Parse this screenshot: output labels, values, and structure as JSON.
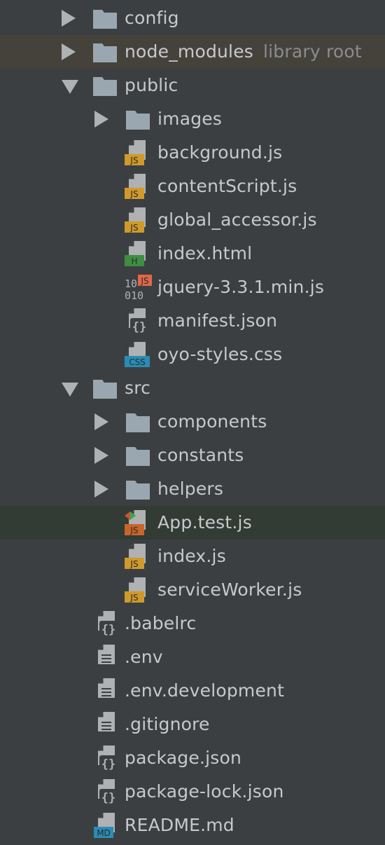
{
  "project_tree": {
    "items": [
      {
        "level": 0,
        "type": "folder",
        "arrow": "collapsed",
        "name": "config",
        "icon": "folder-icon",
        "highlight": ""
      },
      {
        "level": 0,
        "type": "folder",
        "arrow": "collapsed",
        "name": "node_modules",
        "hint": "library root",
        "icon": "folder-icon",
        "highlight": "brown"
      },
      {
        "level": 0,
        "type": "folder",
        "arrow": "expanded",
        "name": "public",
        "icon": "folder-icon",
        "highlight": ""
      },
      {
        "level": 1,
        "type": "folder",
        "arrow": "collapsed",
        "name": "images",
        "icon": "folder-icon",
        "highlight": ""
      },
      {
        "level": 1,
        "type": "file",
        "name": "background.js",
        "icon": "js-file-icon",
        "badge": "JS",
        "badge_color": "#d09a2a",
        "highlight": ""
      },
      {
        "level": 1,
        "type": "file",
        "name": "contentScript.js",
        "icon": "js-file-icon",
        "badge": "JS",
        "badge_color": "#d09a2a",
        "highlight": ""
      },
      {
        "level": 1,
        "type": "file",
        "name": "global_accessor.js",
        "icon": "js-file-icon",
        "badge": "JS",
        "badge_color": "#d09a2a",
        "highlight": ""
      },
      {
        "level": 1,
        "type": "file",
        "name": "index.html",
        "icon": "html-file-icon",
        "badge": "H",
        "badge_color": "#3e8e41",
        "highlight": ""
      },
      {
        "level": 1,
        "type": "file",
        "name": "jquery-3.3.1.min.js",
        "icon": "minified-js-file-icon",
        "badge": "JS",
        "badge_color": "#e0674a",
        "highlight": ""
      },
      {
        "level": 1,
        "type": "file",
        "name": "manifest.json",
        "icon": "json-file-icon",
        "highlight": ""
      },
      {
        "level": 1,
        "type": "file",
        "name": "oyo-styles.css",
        "icon": "css-file-icon",
        "badge": "CSS",
        "badge_color": "#2a8cb4",
        "highlight": ""
      },
      {
        "level": 0,
        "type": "folder",
        "arrow": "expanded",
        "name": "src",
        "icon": "folder-icon",
        "highlight": ""
      },
      {
        "level": 1,
        "type": "folder",
        "arrow": "collapsed",
        "name": "components",
        "icon": "folder-icon",
        "highlight": ""
      },
      {
        "level": 1,
        "type": "folder",
        "arrow": "collapsed",
        "name": "constants",
        "icon": "folder-icon",
        "highlight": ""
      },
      {
        "level": 1,
        "type": "folder",
        "arrow": "collapsed",
        "name": "helpers",
        "icon": "folder-icon",
        "highlight": ""
      },
      {
        "level": 1,
        "type": "file",
        "name": "App.test.js",
        "icon": "test-js-file-icon",
        "badge": "JS",
        "badge_color": "#c9652a",
        "highlight": "green"
      },
      {
        "level": 1,
        "type": "file",
        "name": "index.js",
        "icon": "js-file-icon",
        "badge": "JS",
        "badge_color": "#d09a2a",
        "highlight": ""
      },
      {
        "level": 1,
        "type": "file",
        "name": "serviceWorker.js",
        "icon": "js-file-icon",
        "badge": "JS",
        "badge_color": "#d09a2a",
        "highlight": ""
      },
      {
        "level": 0,
        "type": "file",
        "name": ".babelrc",
        "icon": "json-file-icon",
        "highlight": ""
      },
      {
        "level": 0,
        "type": "file",
        "name": ".env",
        "icon": "text-file-icon",
        "highlight": ""
      },
      {
        "level": 0,
        "type": "file",
        "name": ".env.development",
        "icon": "text-file-icon",
        "highlight": ""
      },
      {
        "level": 0,
        "type": "file",
        "name": ".gitignore",
        "icon": "text-file-icon",
        "highlight": ""
      },
      {
        "level": 0,
        "type": "file",
        "name": "package.json",
        "icon": "json-file-icon",
        "highlight": ""
      },
      {
        "level": 0,
        "type": "file",
        "name": "package-lock.json",
        "icon": "json-file-icon",
        "highlight": ""
      },
      {
        "level": 0,
        "type": "file",
        "name": "README.md",
        "icon": "markdown-file-icon",
        "badge": "MD",
        "badge_color": "#2a8cb4",
        "highlight": ""
      }
    ]
  },
  "colors": {
    "background": "#3c3f41",
    "text": "#c7c9cb",
    "hint_text": "#8a8c8e",
    "folder": "#9aa7b0",
    "file_page": "#afb1b3"
  }
}
